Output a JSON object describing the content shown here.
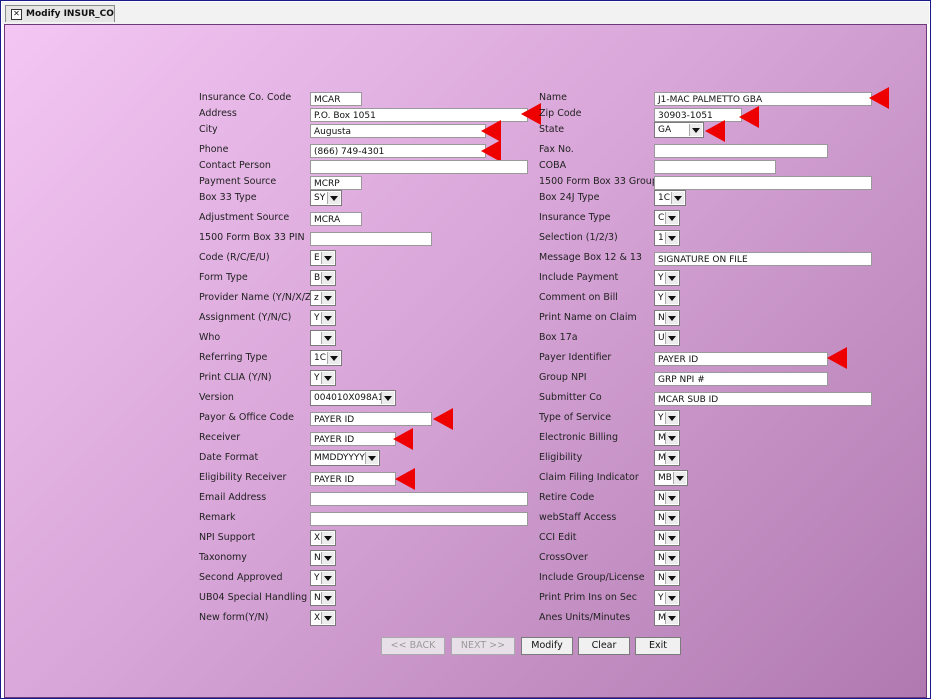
{
  "tab": {
    "title": "Modify INSUR_CO"
  },
  "left_fields": [
    {
      "label": "Insurance Co. Code",
      "value": "MCAR",
      "type": "text"
    },
    {
      "label": "Address",
      "value": "P.O. Box 1051",
      "type": "text"
    },
    {
      "label": "City",
      "value": "Augusta",
      "type": "text"
    },
    {
      "label": "Phone",
      "value": "(866) 749-4301",
      "type": "text"
    },
    {
      "label": "Contact Person",
      "value": "",
      "type": "text"
    },
    {
      "label": "Payment Source",
      "value": "MCRP",
      "type": "text"
    },
    {
      "label": "Box 33 Type",
      "value": "SY",
      "type": "select"
    },
    {
      "label": "Adjustment Source",
      "value": "MCRA",
      "type": "text"
    },
    {
      "label": "1500 Form Box 33 PIN",
      "value": "",
      "type": "text"
    },
    {
      "label": "Code (R/C/E/U)",
      "value": "E",
      "type": "select"
    },
    {
      "label": "Form Type",
      "value": "B",
      "type": "select"
    },
    {
      "label": "Provider Name (Y/N/X/Z)",
      "value": "z",
      "type": "select"
    },
    {
      "label": "Assignment (Y/N/C)",
      "value": "Y",
      "type": "select"
    },
    {
      "label": "Who",
      "value": "",
      "type": "select"
    },
    {
      "label": "Referring Type",
      "value": "1C",
      "type": "select"
    },
    {
      "label": "Print CLIA (Y/N)",
      "value": "Y",
      "type": "select"
    },
    {
      "label": "Version",
      "value": "004010X098A1",
      "type": "select"
    },
    {
      "label": "Payor & Office Code",
      "value": "PAYER ID",
      "type": "text"
    },
    {
      "label": "Receiver",
      "value": "PAYER ID",
      "type": "text"
    },
    {
      "label": "Date Format",
      "value": "MMDDYYYY",
      "type": "select"
    },
    {
      "label": "Eligibility Receiver",
      "value": "PAYER ID",
      "type": "text"
    },
    {
      "label": "Email Address",
      "value": "",
      "type": "text"
    },
    {
      "label": "Remark",
      "value": "",
      "type": "text"
    },
    {
      "label": "NPI Support",
      "value": "X",
      "type": "select"
    },
    {
      "label": "Taxonomy",
      "value": "N",
      "type": "select"
    },
    {
      "label": "Second Approved",
      "value": "Y",
      "type": "select"
    },
    {
      "label": "UB04 Special Handling",
      "value": "N",
      "type": "select"
    },
    {
      "label": "New form(Y/N)",
      "value": "X",
      "type": "select"
    }
  ],
  "right_fields": [
    {
      "label": "Name",
      "value": "J1-MAC PALMETTO GBA",
      "type": "text"
    },
    {
      "label": "Zip Code",
      "value": "30903-1051",
      "type": "text"
    },
    {
      "label": "State",
      "value": "GA",
      "type": "select"
    },
    {
      "label": "Fax No.",
      "value": "",
      "type": "text"
    },
    {
      "label": "COBA",
      "value": "",
      "type": "text"
    },
    {
      "label": "1500 Form Box 33 Group",
      "value": "",
      "type": "text"
    },
    {
      "label": "Box 24J Type",
      "value": "1C",
      "type": "select"
    },
    {
      "label": "Insurance Type",
      "value": "C",
      "type": "select"
    },
    {
      "label": "Selection (1/2/3)",
      "value": "1",
      "type": "select"
    },
    {
      "label": "Message Box 12 & 13",
      "value": "SIGNATURE ON FILE",
      "type": "text"
    },
    {
      "label": "Include Payment",
      "value": "Y",
      "type": "select"
    },
    {
      "label": "Comment on Bill",
      "value": "Y",
      "type": "select"
    },
    {
      "label": "Print Name on Claim",
      "value": "N",
      "type": "select"
    },
    {
      "label": "Box 17a",
      "value": "U",
      "type": "select"
    },
    {
      "label": "Payer Identifier",
      "value": "PAYER ID",
      "type": "text"
    },
    {
      "label": "Group NPI",
      "value": "GRP NPI #",
      "type": "text"
    },
    {
      "label": "Submitter Co",
      "value": "MCAR SUB ID",
      "type": "text"
    },
    {
      "label": "Type of Service",
      "value": "Y",
      "type": "select"
    },
    {
      "label": "Electronic Billing",
      "value": "M",
      "type": "select"
    },
    {
      "label": "Eligibility",
      "value": "M",
      "type": "select"
    },
    {
      "label": "Claim Filing Indicator",
      "value": "MB",
      "type": "select"
    },
    {
      "label": "Retire Code",
      "value": "N",
      "type": "select"
    },
    {
      "label": "webStaff Access",
      "value": "N",
      "type": "select"
    },
    {
      "label": "CCI Edit",
      "value": "N",
      "type": "select"
    },
    {
      "label": "CrossOver",
      "value": "N",
      "type": "select"
    },
    {
      "label": "Include Group/License",
      "value": "N",
      "type": "select"
    },
    {
      "label": "Print Prim Ins on Sec",
      "value": "Y",
      "type": "select"
    },
    {
      "label": "Anes Units/Minutes",
      "value": "M",
      "type": "select"
    }
  ],
  "buttons": {
    "back": "<< BACK",
    "next": "NEXT >>",
    "modify": "Modify",
    "clear": "Clear",
    "exit": "Exit"
  },
  "colors": {
    "annotation_arrow": "#ee0000"
  }
}
